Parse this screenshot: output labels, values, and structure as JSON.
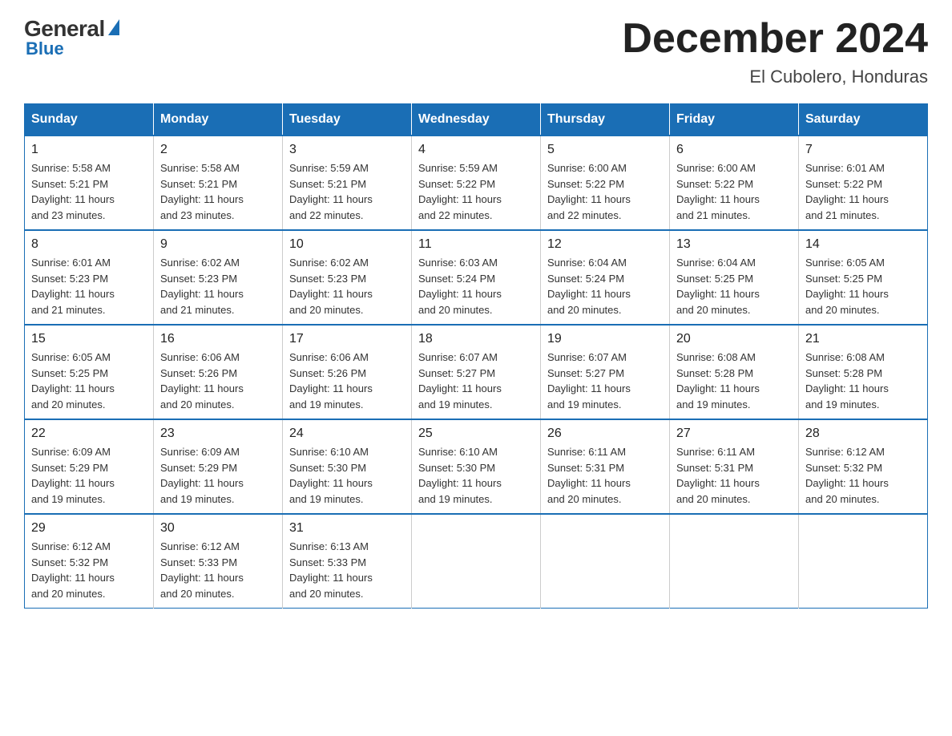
{
  "logo": {
    "general": "General",
    "blue": "Blue"
  },
  "title": "December 2024",
  "subtitle": "El Cubolero, Honduras",
  "days_header": [
    "Sunday",
    "Monday",
    "Tuesday",
    "Wednesday",
    "Thursday",
    "Friday",
    "Saturday"
  ],
  "weeks": [
    [
      {
        "day": "1",
        "sunrise": "5:58 AM",
        "sunset": "5:21 PM",
        "daylight": "11 hours and 23 minutes."
      },
      {
        "day": "2",
        "sunrise": "5:58 AM",
        "sunset": "5:21 PM",
        "daylight": "11 hours and 23 minutes."
      },
      {
        "day": "3",
        "sunrise": "5:59 AM",
        "sunset": "5:21 PM",
        "daylight": "11 hours and 22 minutes."
      },
      {
        "day": "4",
        "sunrise": "5:59 AM",
        "sunset": "5:22 PM",
        "daylight": "11 hours and 22 minutes."
      },
      {
        "day": "5",
        "sunrise": "6:00 AM",
        "sunset": "5:22 PM",
        "daylight": "11 hours and 22 minutes."
      },
      {
        "day": "6",
        "sunrise": "6:00 AM",
        "sunset": "5:22 PM",
        "daylight": "11 hours and 21 minutes."
      },
      {
        "day": "7",
        "sunrise": "6:01 AM",
        "sunset": "5:22 PM",
        "daylight": "11 hours and 21 minutes."
      }
    ],
    [
      {
        "day": "8",
        "sunrise": "6:01 AM",
        "sunset": "5:23 PM",
        "daylight": "11 hours and 21 minutes."
      },
      {
        "day": "9",
        "sunrise": "6:02 AM",
        "sunset": "5:23 PM",
        "daylight": "11 hours and 21 minutes."
      },
      {
        "day": "10",
        "sunrise": "6:02 AM",
        "sunset": "5:23 PM",
        "daylight": "11 hours and 20 minutes."
      },
      {
        "day": "11",
        "sunrise": "6:03 AM",
        "sunset": "5:24 PM",
        "daylight": "11 hours and 20 minutes."
      },
      {
        "day": "12",
        "sunrise": "6:04 AM",
        "sunset": "5:24 PM",
        "daylight": "11 hours and 20 minutes."
      },
      {
        "day": "13",
        "sunrise": "6:04 AM",
        "sunset": "5:25 PM",
        "daylight": "11 hours and 20 minutes."
      },
      {
        "day": "14",
        "sunrise": "6:05 AM",
        "sunset": "5:25 PM",
        "daylight": "11 hours and 20 minutes."
      }
    ],
    [
      {
        "day": "15",
        "sunrise": "6:05 AM",
        "sunset": "5:25 PM",
        "daylight": "11 hours and 20 minutes."
      },
      {
        "day": "16",
        "sunrise": "6:06 AM",
        "sunset": "5:26 PM",
        "daylight": "11 hours and 20 minutes."
      },
      {
        "day": "17",
        "sunrise": "6:06 AM",
        "sunset": "5:26 PM",
        "daylight": "11 hours and 19 minutes."
      },
      {
        "day": "18",
        "sunrise": "6:07 AM",
        "sunset": "5:27 PM",
        "daylight": "11 hours and 19 minutes."
      },
      {
        "day": "19",
        "sunrise": "6:07 AM",
        "sunset": "5:27 PM",
        "daylight": "11 hours and 19 minutes."
      },
      {
        "day": "20",
        "sunrise": "6:08 AM",
        "sunset": "5:28 PM",
        "daylight": "11 hours and 19 minutes."
      },
      {
        "day": "21",
        "sunrise": "6:08 AM",
        "sunset": "5:28 PM",
        "daylight": "11 hours and 19 minutes."
      }
    ],
    [
      {
        "day": "22",
        "sunrise": "6:09 AM",
        "sunset": "5:29 PM",
        "daylight": "11 hours and 19 minutes."
      },
      {
        "day": "23",
        "sunrise": "6:09 AM",
        "sunset": "5:29 PM",
        "daylight": "11 hours and 19 minutes."
      },
      {
        "day": "24",
        "sunrise": "6:10 AM",
        "sunset": "5:30 PM",
        "daylight": "11 hours and 19 minutes."
      },
      {
        "day": "25",
        "sunrise": "6:10 AM",
        "sunset": "5:30 PM",
        "daylight": "11 hours and 19 minutes."
      },
      {
        "day": "26",
        "sunrise": "6:11 AM",
        "sunset": "5:31 PM",
        "daylight": "11 hours and 20 minutes."
      },
      {
        "day": "27",
        "sunrise": "6:11 AM",
        "sunset": "5:31 PM",
        "daylight": "11 hours and 20 minutes."
      },
      {
        "day": "28",
        "sunrise": "6:12 AM",
        "sunset": "5:32 PM",
        "daylight": "11 hours and 20 minutes."
      }
    ],
    [
      {
        "day": "29",
        "sunrise": "6:12 AM",
        "sunset": "5:32 PM",
        "daylight": "11 hours and 20 minutes."
      },
      {
        "day": "30",
        "sunrise": "6:12 AM",
        "sunset": "5:33 PM",
        "daylight": "11 hours and 20 minutes."
      },
      {
        "day": "31",
        "sunrise": "6:13 AM",
        "sunset": "5:33 PM",
        "daylight": "11 hours and 20 minutes."
      },
      null,
      null,
      null,
      null
    ]
  ],
  "labels": {
    "sunrise": "Sunrise:",
    "sunset": "Sunset:",
    "daylight": "Daylight:"
  }
}
